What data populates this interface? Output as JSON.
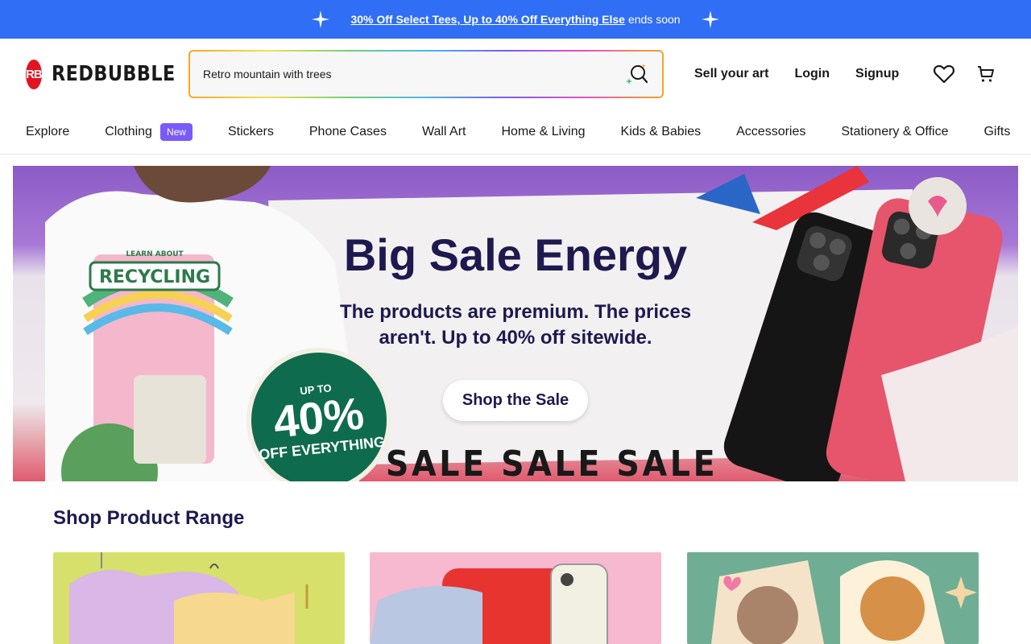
{
  "promo": {
    "link_text": "30% Off Select Tees, Up to 40% Off Everything Else",
    "suffix": "ends soon"
  },
  "header": {
    "logo_mark": "RB",
    "logo_text": "REDBUBBLE",
    "search_value": "Retro mountain with trees",
    "links": {
      "sell": "Sell your art",
      "login": "Login",
      "signup": "Signup"
    },
    "icons": [
      "wishlist-heart-icon",
      "cart-icon",
      "search-sparkle-icon"
    ]
  },
  "nav": {
    "items": [
      {
        "label": "Explore"
      },
      {
        "label": "Clothing",
        "badge": "New"
      },
      {
        "label": "Stickers"
      },
      {
        "label": "Phone Cases"
      },
      {
        "label": "Wall Art"
      },
      {
        "label": "Home & Living"
      },
      {
        "label": "Kids & Babies"
      },
      {
        "label": "Accessories"
      },
      {
        "label": "Stationery & Office"
      },
      {
        "label": "Gifts"
      }
    ]
  },
  "hero": {
    "title": "Big Sale Energy",
    "subtitle": "The products are premium. The prices aren't. Up to 40% off sitewide.",
    "cta": "Shop the Sale",
    "badge_top": "UP TO",
    "badge_percent": "40%",
    "badge_bottom": "OFF EVERYTHING",
    "strip_text": "SALE SALE SALE",
    "shirt_text": "RECYCLING",
    "shirt_small": "LEARN ABOUT"
  },
  "range": {
    "title": "Shop Product Range"
  },
  "colors": {
    "promo_bg": "#2f6ef5",
    "brand_red": "#e41321",
    "heading_navy": "#1e1a4f",
    "badge_purple": "#7a5af8"
  }
}
